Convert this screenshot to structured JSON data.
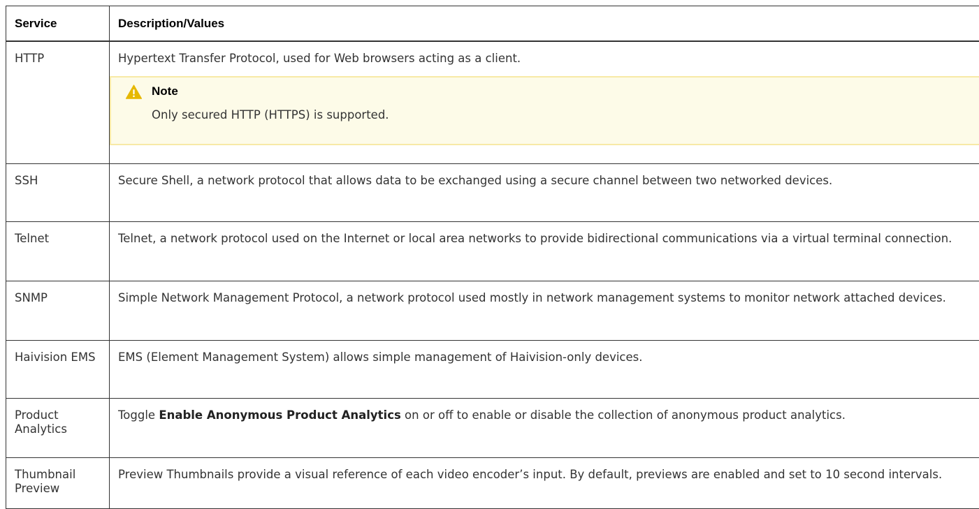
{
  "table": {
    "headers": [
      "Service",
      "Description/Values"
    ],
    "rows": [
      {
        "service": "HTTP",
        "description": "Hypertext Transfer Protocol, used for Web browsers acting as a client.",
        "note": {
          "icon": "warning-icon",
          "title": "Note",
          "text": "Only secured HTTP (HTTPS) is supported.",
          "background": "#fdfbe8",
          "border": "#f7e9a6",
          "icon_color": "#e6b800"
        }
      },
      {
        "service": "SSH",
        "description": "Secure Shell, a network protocol that allows data to be exchanged using a secure channel between two networked devices."
      },
      {
        "service": "Telnet",
        "description": "Telnet, a network protocol used on the Internet or local area networks to provide bidirectional communications via a virtual terminal connection."
      },
      {
        "service": "SNMP",
        "description": "Simple Network Management Protocol, a network protocol used mostly in network management systems to monitor network attached devices."
      },
      {
        "service": "Haivision EMS",
        "description": "EMS (Element Management System) allows simple management of Haivision-only devices."
      },
      {
        "service": "Product Analytics",
        "description_before": "Toggle ",
        "description_strong": "Enable Anonymous Product Analytics",
        "description_after": " on or off to enable or disable the collection of anonymous product analytics."
      },
      {
        "service": "Thumbnail Preview",
        "description": "Preview Thumbnails provide a visual reference of each video encoder’s input. By default, previews are enabled and set to 10 second intervals."
      }
    ]
  }
}
